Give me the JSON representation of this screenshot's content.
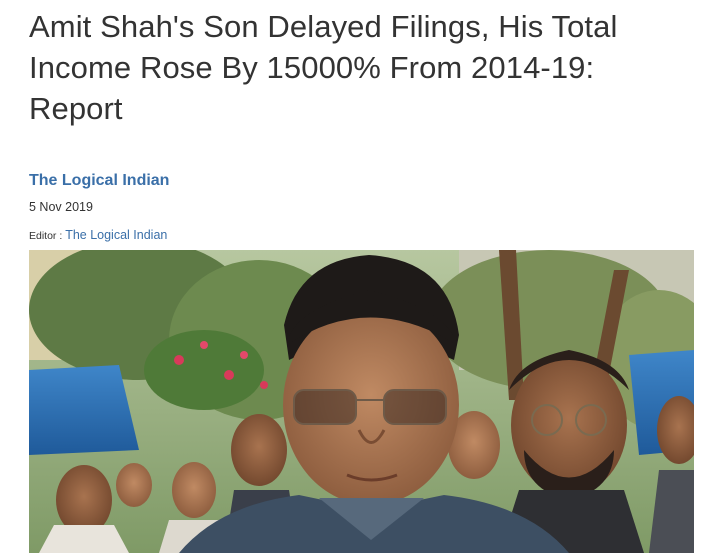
{
  "article": {
    "headline": "Amit Shah's Son Delayed Filings, His Total Income Rose By 15000% From 2014-19: Report",
    "author": "The Logical Indian",
    "date": "5 Nov 2019",
    "editor_label": "Editor : ",
    "editor_name": "The Logical Indian"
  },
  "colors": {
    "link": "#3a6fa8",
    "headline": "#333333"
  },
  "hero_image": {
    "icon": "news-photo"
  }
}
